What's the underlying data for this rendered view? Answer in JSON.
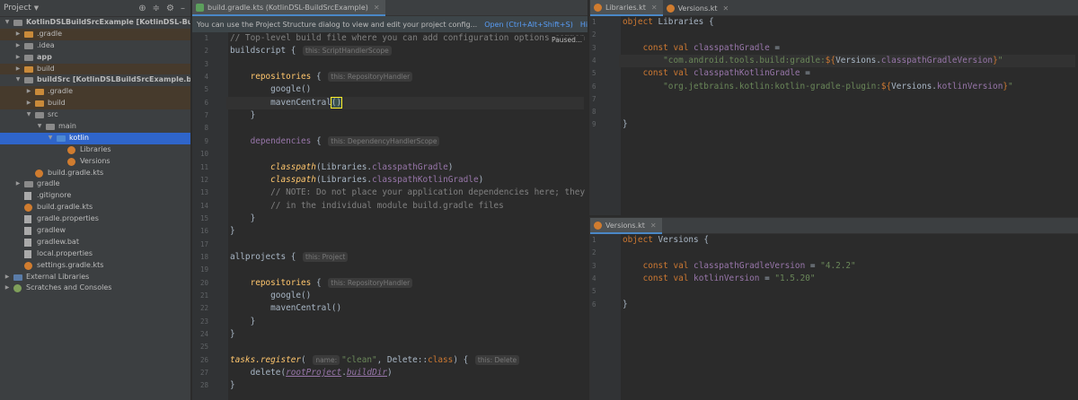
{
  "project": {
    "title": "Project",
    "tree": [
      {
        "label": "KotlinDSLBuildSrcExample",
        "suffix": "[KotlinDSL-BuildSrcExample]",
        "depth": 0,
        "arrow": "down",
        "icon": "folder",
        "excluded": false,
        "selected": false,
        "bold": true
      },
      {
        "label": ".gradle",
        "depth": 1,
        "arrow": "right",
        "icon": "folder-orange",
        "excluded": true
      },
      {
        "label": ".idea",
        "depth": 1,
        "arrow": "right",
        "icon": "folder"
      },
      {
        "label": "app",
        "depth": 1,
        "arrow": "right",
        "icon": "folder",
        "bold": true
      },
      {
        "label": "build",
        "depth": 1,
        "arrow": "right",
        "icon": "folder-orange",
        "excluded": true
      },
      {
        "label": "buildSrc",
        "suffix": "[KotlinDSLBuildSrcExample.buildSrc]",
        "depth": 1,
        "arrow": "down",
        "icon": "folder",
        "bold": true
      },
      {
        "label": ".gradle",
        "depth": 2,
        "arrow": "right",
        "icon": "folder-orange",
        "excluded": true
      },
      {
        "label": "build",
        "depth": 2,
        "arrow": "right",
        "icon": "folder-orange",
        "excluded": true
      },
      {
        "label": "src",
        "depth": 2,
        "arrow": "down",
        "icon": "folder"
      },
      {
        "label": "main",
        "depth": 3,
        "arrow": "down",
        "icon": "folder"
      },
      {
        "label": "kotlin",
        "depth": 4,
        "arrow": "down",
        "icon": "folder-blue",
        "selected": true
      },
      {
        "label": "Libraries",
        "depth": 5,
        "arrow": "",
        "icon": "kt"
      },
      {
        "label": "Versions",
        "depth": 5,
        "arrow": "",
        "icon": "kt"
      },
      {
        "label": "build.gradle.kts",
        "depth": 2,
        "arrow": "",
        "icon": "kt"
      },
      {
        "label": "gradle",
        "depth": 1,
        "arrow": "right",
        "icon": "folder"
      },
      {
        "label": ".gitignore",
        "depth": 1,
        "arrow": "",
        "icon": "file"
      },
      {
        "label": "build.gradle.kts",
        "depth": 1,
        "arrow": "",
        "icon": "kt"
      },
      {
        "label": "gradle.properties",
        "depth": 1,
        "arrow": "",
        "icon": "file"
      },
      {
        "label": "gradlew",
        "depth": 1,
        "arrow": "",
        "icon": "file"
      },
      {
        "label": "gradlew.bat",
        "depth": 1,
        "arrow": "",
        "icon": "file"
      },
      {
        "label": "local.properties",
        "depth": 1,
        "arrow": "",
        "icon": "file"
      },
      {
        "label": "settings.gradle.kts",
        "depth": 1,
        "arrow": "",
        "icon": "kt"
      },
      {
        "label": "External Libraries",
        "depth": 0,
        "arrow": "right",
        "icon": "lib"
      },
      {
        "label": "Scratches and Consoles",
        "depth": 0,
        "arrow": "right",
        "icon": "scr"
      }
    ]
  },
  "main_editor": {
    "tab": "build.gradle.kts (KotlinDSL-BuildSrcExample)",
    "notification": {
      "text": "You can use the Project Structure dialog to view and edit your project config...",
      "open_link": "Open (Ctrl+Alt+Shift+S)",
      "hide_link": "Hide notification"
    },
    "paused": "Paused...",
    "lines": [
      [
        [
          "com",
          "// Top-level build file where you can add configuration options common"
        ]
      ],
      [
        [
          "pl",
          "buildscript { "
        ],
        [
          "hint",
          "this: ScriptHandlerScope"
        ]
      ],
      [],
      [
        [
          "pl",
          "    "
        ],
        [
          "fn",
          "repositories"
        ],
        [
          "pl",
          " { "
        ],
        [
          "hint",
          "this: RepositoryHandler"
        ]
      ],
      [
        [
          "pl",
          "        google()"
        ]
      ],
      [
        [
          "pl",
          "        mavenCentral"
        ],
        [
          "brace",
          "()"
        ]
      ],
      [
        [
          "pl",
          "    }"
        ]
      ],
      [],
      [
        [
          "pl",
          "    "
        ],
        [
          "mem",
          "dependencies"
        ],
        [
          "pl",
          " { "
        ],
        [
          "hint",
          "this: DependencyHandlerScope"
        ]
      ],
      [],
      [
        [
          "pl",
          "        "
        ],
        [
          "fni",
          "classpath"
        ],
        [
          "pl",
          "(Libraries."
        ],
        [
          "mem",
          "classpathGradle"
        ],
        [
          "pl",
          ")"
        ]
      ],
      [
        [
          "pl",
          "        "
        ],
        [
          "fni",
          "classpath"
        ],
        [
          "pl",
          "(Libraries."
        ],
        [
          "mem",
          "classpathKotlinGradle"
        ],
        [
          "pl",
          ")"
        ]
      ],
      [
        [
          "com",
          "        // NOTE: Do not place your application dependencies here; they belong"
        ]
      ],
      [
        [
          "com",
          "        // in the individual module build.gradle files"
        ]
      ],
      [
        [
          "pl",
          "    }"
        ]
      ],
      [
        [
          "pl",
          "}"
        ]
      ],
      [],
      [
        [
          "pl",
          "allprojects { "
        ],
        [
          "hint",
          "this: Project"
        ]
      ],
      [],
      [
        [
          "pl",
          "    "
        ],
        [
          "fn",
          "repositories"
        ],
        [
          "pl",
          " { "
        ],
        [
          "hint",
          "this: RepositoryHandler"
        ]
      ],
      [
        [
          "pl",
          "        google()"
        ]
      ],
      [
        [
          "pl",
          "        mavenCentral()"
        ]
      ],
      [
        [
          "pl",
          "    }"
        ]
      ],
      [
        [
          "pl",
          "}"
        ]
      ],
      [],
      [
        [
          "fni",
          "tasks.register"
        ],
        [
          "pl",
          "( "
        ],
        [
          "hint",
          "name:"
        ],
        [
          "str",
          "\"clean\""
        ],
        [
          "pl",
          ", Delete::"
        ],
        [
          "kw",
          "class"
        ],
        [
          "pl",
          ") { "
        ],
        [
          "hint",
          "this: Delete"
        ]
      ],
      [
        [
          "pl",
          "    delete("
        ],
        [
          "idx",
          "rootProject"
        ],
        [
          "pl",
          "."
        ],
        [
          "idx",
          "buildDir"
        ],
        [
          "pl",
          ")"
        ]
      ],
      [
        [
          "pl",
          "}"
        ]
      ]
    ]
  },
  "libraries_editor": {
    "tabs": [
      "Libraries.kt",
      "Versions.kt"
    ],
    "lines": [
      [
        [
          "kw",
          "object"
        ],
        [
          "pl",
          " Libraries {"
        ]
      ],
      [],
      [
        [
          "pl",
          "    "
        ],
        [
          "kw",
          "const val"
        ],
        [
          "pl",
          " "
        ],
        [
          "mem",
          "classpathGradle"
        ],
        [
          "pl",
          " ="
        ]
      ],
      [
        [
          "str",
          "        \"com.android.tools.build:gradle:"
        ],
        [
          "kw",
          "${"
        ],
        [
          "pl",
          "Versions."
        ],
        [
          "mem",
          "classpathGradleVersion"
        ],
        [
          "kw",
          "}"
        ],
        [
          "str",
          "\""
        ]
      ],
      [
        [
          "pl",
          "    "
        ],
        [
          "kw",
          "const val"
        ],
        [
          "pl",
          " "
        ],
        [
          "mem",
          "classpathKotlinGradle"
        ],
        [
          "pl",
          " ="
        ]
      ],
      [
        [
          "str",
          "        \"org.jetbrains.kotlin:kotlin-gradle-plugin:"
        ],
        [
          "kw",
          "${"
        ],
        [
          "pl",
          "Versions."
        ],
        [
          "mem",
          "kotlinVersion"
        ],
        [
          "kw",
          "}"
        ],
        [
          "str",
          "\""
        ]
      ],
      [],
      [],
      [
        [
          "pl",
          "}"
        ]
      ]
    ]
  },
  "versions_editor": {
    "tab": "Versions.kt",
    "lines": [
      [
        [
          "kw",
          "object"
        ],
        [
          "pl",
          " Versions {"
        ]
      ],
      [],
      [
        [
          "pl",
          "    "
        ],
        [
          "kw",
          "const val"
        ],
        [
          "pl",
          " "
        ],
        [
          "mem",
          "classpathGradleVersion"
        ],
        [
          "pl",
          " = "
        ],
        [
          "str",
          "\"4.2.2\""
        ]
      ],
      [
        [
          "pl",
          "    "
        ],
        [
          "kw",
          "const val"
        ],
        [
          "pl",
          " "
        ],
        [
          "mem",
          "kotlinVersion"
        ],
        [
          "pl",
          " = "
        ],
        [
          "str",
          "\"1.5.20\""
        ]
      ],
      [],
      [
        [
          "pl",
          "}"
        ]
      ]
    ]
  }
}
